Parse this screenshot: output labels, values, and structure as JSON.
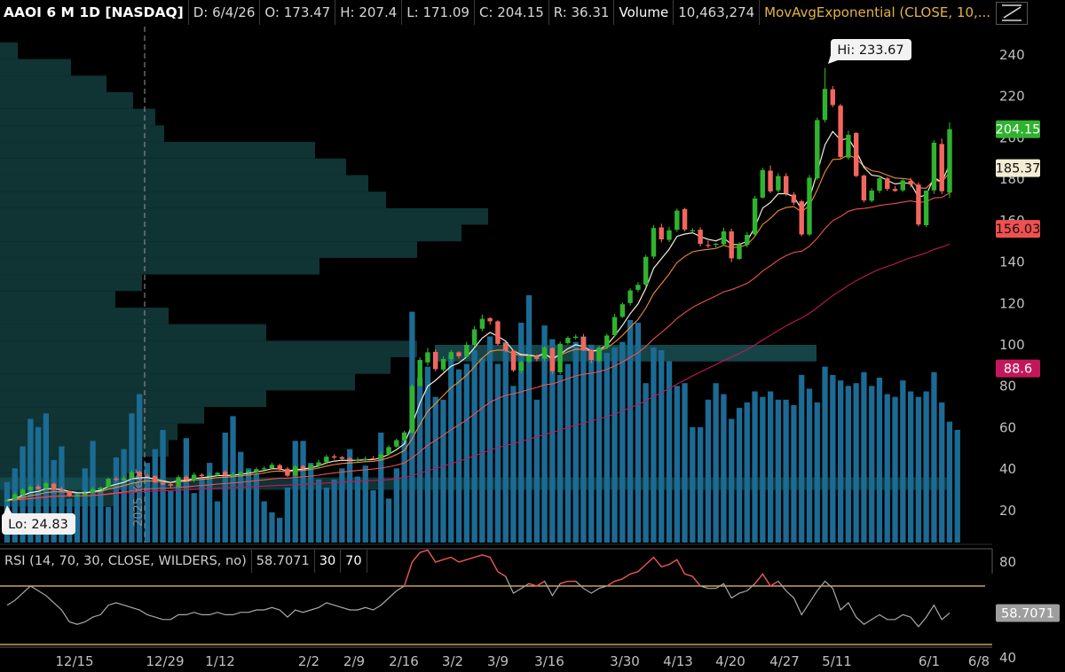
{
  "header": {
    "symbol_label": "AAOI 6 M 1D [NASDAQ]",
    "date": "D: 6/4/26",
    "open": "O: 173.47",
    "high": "H: 207.4",
    "low": "L: 171.09",
    "close": "C: 204.15",
    "range": "R: 36.31",
    "volume_label": "Volume",
    "volume_value": "10,463,274",
    "study_label": "MovAvgExponential (CLOSE, 10,..."
  },
  "rsi_header": {
    "label": "RSI (14, 70, 30, CLOSE, WILDERS, no)",
    "value": "58.7071",
    "lower": "30",
    "upper": "70"
  },
  "colors": {
    "up": "#2fb32f",
    "down": "#f2665f",
    "volume": "#1b6b94",
    "profile": "#0f3433",
    "value_area": "#1d5b5e",
    "ema_fast": "#f3edd6",
    "ema_mid": "#f08b3c",
    "ema_slow": "#f05050",
    "sma_long": "#c2185b",
    "rsi_line": "#a9a9a9",
    "rsi_over": "#f05050",
    "rsi_band": "#f0c36b",
    "tag_close": "#2fb32f",
    "tag_ema": "#f3edd6",
    "tag_slow": "#f05050",
    "tag_long": "#c2185b",
    "tag_rsi": "#9e9e9e",
    "axis_text": "#bfbfbf"
  },
  "chart_data": [
    {
      "type": "candlestick",
      "title": "AAOI 6 M 1D [NASDAQ]",
      "x_ticks": [
        "12/15",
        "12/29",
        "1/12",
        "2/2",
        "2/9",
        "2/16",
        "3/2",
        "3/9",
        "3/16",
        "3/30",
        "4/13",
        "4/20",
        "4/27",
        "5/11",
        "6/1",
        "6/8"
      ],
      "year_marker": "2025 Year",
      "y_ticks": [
        20,
        40,
        60,
        80,
        100,
        120,
        140,
        160,
        180,
        200,
        220,
        240
      ],
      "ylim": [
        4,
        252
      ],
      "grid": false,
      "x": [
        "12/8",
        "12/9",
        "12/10",
        "12/11",
        "12/12",
        "12/15",
        "12/16",
        "12/17",
        "12/18",
        "12/19",
        "12/22",
        "12/23",
        "12/24",
        "12/26",
        "12/29",
        "12/30",
        "12/31",
        "1/2",
        "1/5",
        "1/6",
        "1/7",
        "1/8",
        "1/9",
        "1/12",
        "1/13",
        "1/14",
        "1/15",
        "1/16",
        "1/20",
        "1/21",
        "1/22",
        "1/23",
        "1/26",
        "1/27",
        "1/28",
        "1/29",
        "1/30",
        "2/2",
        "2/3",
        "2/4",
        "2/5",
        "2/6",
        "2/9",
        "2/10",
        "2/11",
        "2/12",
        "2/13",
        "2/17",
        "2/18",
        "2/19",
        "2/20",
        "2/23",
        "2/24",
        "2/25",
        "2/26",
        "2/27",
        "3/2",
        "3/3",
        "3/4",
        "3/5",
        "3/6",
        "3/9",
        "3/10",
        "3/11",
        "3/12",
        "3/13",
        "3/16",
        "3/17",
        "3/18",
        "3/19",
        "3/20",
        "3/23",
        "3/24",
        "3/25",
        "3/26",
        "3/27",
        "3/30",
        "3/31",
        "4/1",
        "4/2",
        "4/6",
        "4/7",
        "4/8",
        "4/9",
        "4/10",
        "4/13",
        "4/14",
        "4/15",
        "4/16",
        "4/17",
        "4/20",
        "4/21",
        "4/22",
        "4/23",
        "4/24",
        "4/27",
        "4/28",
        "4/29",
        "4/30",
        "5/1",
        "5/4",
        "5/5",
        "5/6",
        "5/7",
        "5/8",
        "5/11",
        "5/12",
        "5/13",
        "5/14",
        "5/15",
        "5/18",
        "5/19",
        "5/20",
        "5/21",
        "5/22",
        "5/26",
        "5/27",
        "5/28",
        "5/29",
        "6/1",
        "6/2",
        "6/3",
        "6/4"
      ],
      "open": [
        24.8,
        25.2,
        27.5,
        29.9,
        31.6,
        30.5,
        32.9,
        30.1,
        29.3,
        26.8,
        27.4,
        28.6,
        30.1,
        31.3,
        35.4,
        34.5,
        35.6,
        38.6,
        36.8,
        36.6,
        33.4,
        32.7,
        31.6,
        36.3,
        34.7,
        37.3,
        36.8,
        37.3,
        38.7,
        36.8,
        37.4,
        38.3,
        38.7,
        40.1,
        40.5,
        41.9,
        40.2,
        36.9,
        41.5,
        40.4,
        41.6,
        43.3,
        46.2,
        45.8,
        45.2,
        44.1,
        44.3,
        45.2,
        45.0,
        47.4,
        50.9,
        53.7,
        57.7,
        80.2,
        91.5,
        96.6,
        88.1,
        93.2,
        96.4,
        94.3,
        100.0,
        107.8,
        112.9,
        111.4,
        100.8,
        97.2,
        87.5,
        91.8,
        94.7,
        93.3,
        98.4,
        86.7,
        100.9,
        103.4,
        103.9,
        97.6,
        92.2,
        98.9,
        104.7,
        113.5,
        120.2,
        126.6,
        129.1,
        142.6,
        156.7,
        150.7,
        155.6,
        165.6,
        155.3,
        155.6,
        148.3,
        148.3,
        148.6,
        154.8,
        141.5,
        148.3,
        153.3,
        171.1,
        184.1,
        174.6,
        181.5,
        172.6,
        169.3,
        153.3,
        180.4,
        208.6,
        223.4,
        215.5,
        190.4,
        202.3,
        181.7,
        169.6,
        174.4,
        180.4,
        175.3,
        174.6,
        179.2,
        177.4,
        157.8,
        174.6,
        197.0,
        173.5
      ],
      "close": [
        24.9,
        27.8,
        30.2,
        31.4,
        30.4,
        33.2,
        30.0,
        29.6,
        27.3,
        27.5,
        28.4,
        30.4,
        30.9,
        35.3,
        34.8,
        35.6,
        38.5,
        36.9,
        36.3,
        33.6,
        32.6,
        32.0,
        36.1,
        34.7,
        37.3,
        36.6,
        37.0,
        38.2,
        36.9,
        37.4,
        38.5,
        39.0,
        40.0,
        40.4,
        42.1,
        40.0,
        36.8,
        41.3,
        40.4,
        42.0,
        43.3,
        46.0,
        45.6,
        45.0,
        44.2,
        44.4,
        45.0,
        44.8,
        47.1,
        50.6,
        54.0,
        57.7,
        80.2,
        92.7,
        96.4,
        88.3,
        93.2,
        96.5,
        94.5,
        100.0,
        107.5,
        112.6,
        111.4,
        100.5,
        97.2,
        87.7,
        91.7,
        94.6,
        93.2,
        98.8,
        87.3,
        100.5,
        103.4,
        104.0,
        97.3,
        92.7,
        98.7,
        104.5,
        113.4,
        119.6,
        126.3,
        129.0,
        142.5,
        156.4,
        150.9,
        155.3,
        164.8,
        155.7,
        155.3,
        148.8,
        148.1,
        148.8,
        154.8,
        141.8,
        148.5,
        153.1,
        170.7,
        184.4,
        174.1,
        181.5,
        173.1,
        168.7,
        153.3,
        180.7,
        208.5,
        223.6,
        215.8,
        190.7,
        201.4,
        181.5,
        169.7,
        174.5,
        180.4,
        175.3,
        174.3,
        179.4,
        177.4,
        158.1,
        174.5,
        197.6,
        174.2,
        204.15
      ],
      "high": [
        25.5,
        28.8,
        30.9,
        32.4,
        32.6,
        34.2,
        33.5,
        31.4,
        29.6,
        28.2,
        29.6,
        31.4,
        31.6,
        35.9,
        36.4,
        36.6,
        39.6,
        39.1,
        37.6,
        37.1,
        34.3,
        33.6,
        37.1,
        37.0,
        38.3,
        38.0,
        38.4,
        38.6,
        39.5,
        38.8,
        39.1,
        39.7,
        40.8,
        41.4,
        43.1,
        42.6,
        41.0,
        42.1,
        42.0,
        42.6,
        44.5,
        47.0,
        47.2,
        46.3,
        45.9,
        45.7,
        46.1,
        46.3,
        48.5,
        51.5,
        54.7,
        58.5,
        81.1,
        93.9,
        98.5,
        97.8,
        94.4,
        97.6,
        96.9,
        101.5,
        109.1,
        114.7,
        113.4,
        111.9,
        101.4,
        97.6,
        92.5,
        95.4,
        95.3,
        99.3,
        98.7,
        101.6,
        104.1,
        105.0,
        105.3,
        97.9,
        99.7,
        105.4,
        114.9,
        120.6,
        127.3,
        130.3,
        143.5,
        157.9,
        158.5,
        157.0,
        165.8,
        166.2,
        156.3,
        156.7,
        150.4,
        149.1,
        156.6,
        156.1,
        149.7,
        154.4,
        171.9,
        185.5,
        186.6,
        182.9,
        182.9,
        173.8,
        170.1,
        182.0,
        209.7,
        233.7,
        225.0,
        216.4,
        203.4,
        202.8,
        182.3,
        175.7,
        181.5,
        181.1,
        176.7,
        180.5,
        180.7,
        178.5,
        174.7,
        198.8,
        199.6,
        207.4
      ],
      "low": [
        24.83,
        24.6,
        26.7,
        28.9,
        30.1,
        29.9,
        29.6,
        28.9,
        26.5,
        26.4,
        26.6,
        28.1,
        30.3,
        30.9,
        34.0,
        34.1,
        34.9,
        35.7,
        36.0,
        33.1,
        32.1,
        31.1,
        30.8,
        34.0,
        33.6,
        35.9,
        36.0,
        36.6,
        36.5,
        36.1,
        36.9,
        37.4,
        37.9,
        39.5,
        40.2,
        39.0,
        36.2,
        36.3,
        39.4,
        40.0,
        40.6,
        42.4,
        44.7,
        44.6,
        43.1,
        43.4,
        43.8,
        44.5,
        44.5,
        46.6,
        50.3,
        53.1,
        57.0,
        79.9,
        90.0,
        87.2,
        87.1,
        92.0,
        93.4,
        93.8,
        99.2,
        106.6,
        109.7,
        99.7,
        96.5,
        86.9,
        86.3,
        91.3,
        92.1,
        92.1,
        86.0,
        85.8,
        100.1,
        102.6,
        97.1,
        91.2,
        91.4,
        97.9,
        103.8,
        113.0,
        119.0,
        125.5,
        128.1,
        141.6,
        149.5,
        149.7,
        154.6,
        154.8,
        154.2,
        147.5,
        146.8,
        147.1,
        147.7,
        140.0,
        141.1,
        147.0,
        152.6,
        170.6,
        173.3,
        173.6,
        171.8,
        167.5,
        152.4,
        152.5,
        179.5,
        207.4,
        214.8,
        189.7,
        189.4,
        181.0,
        168.8,
        168.9,
        173.3,
        174.3,
        173.9,
        173.9,
        176.0,
        157.2,
        156.8,
        172.9,
        172.8,
        171.09
      ],
      "hi_label": "Hi: 233.67",
      "lo_label": "Lo: 24.83",
      "price_tags": {
        "last": "204.15",
        "ema": "185.37",
        "ema_slow": "156.03",
        "sma": "88.6"
      }
    },
    {
      "type": "bar",
      "series_name": "Volume",
      "relative_values": [
        0.22,
        0.27,
        0.35,
        0.45,
        0.42,
        0.47,
        0.3,
        0.35,
        0.16,
        0.18,
        0.27,
        0.37,
        0.2,
        0.13,
        0.31,
        0.34,
        0.47,
        0.54,
        0.29,
        0.34,
        0.41,
        0.19,
        0.21,
        0.38,
        0.18,
        0.23,
        0.29,
        0.15,
        0.4,
        0.46,
        0.33,
        0.27,
        0.25,
        0.15,
        0.11,
        0.09,
        0.2,
        0.37,
        0.37,
        0.29,
        0.23,
        0.2,
        0.23,
        0.27,
        0.34,
        0.24,
        0.28,
        0.19,
        0.4,
        0.16,
        0.27,
        0.37,
        0.84,
        0.6,
        0.64,
        0.53,
        0.52,
        0.68,
        0.63,
        0.65,
        0.7,
        0.67,
        0.75,
        0.65,
        0.73,
        0.57,
        0.8,
        0.9,
        0.52,
        0.79,
        0.74,
        0.61,
        0.65,
        0.73,
        0.75,
        0.72,
        0.71,
        0.69,
        0.71,
        0.73,
        0.81,
        0.8,
        0.58,
        0.71,
        0.7,
        0.66,
        0.57,
        0.58,
        0.42,
        0.42,
        0.52,
        0.58,
        0.54,
        0.45,
        0.49,
        0.51,
        0.55,
        0.53,
        0.55,
        0.52,
        0.52,
        0.5,
        0.61,
        0.56,
        0.51,
        0.64,
        0.61,
        0.59,
        0.57,
        0.58,
        0.62,
        0.57,
        0.6,
        0.54,
        0.53,
        0.59,
        0.55,
        0.53,
        0.55,
        0.62,
        0.51,
        0.44,
        0.41
      ]
    },
    {
      "type": "line",
      "title": "RSI (14, 70, 30, CLOSE, WILDERS, no)",
      "y_ticks": [
        40,
        80
      ],
      "ylim": [
        30,
        88
      ],
      "band": 70,
      "values": [
        62,
        64,
        67,
        70,
        68,
        66,
        63,
        60,
        55,
        54,
        55,
        57,
        58,
        62,
        63,
        62,
        61,
        60,
        58,
        57,
        56,
        56,
        58,
        58,
        59,
        58,
        58,
        59,
        58,
        58,
        59,
        59,
        60,
        60,
        61,
        60,
        57,
        60,
        59,
        60,
        61,
        63,
        62,
        61,
        60,
        60,
        61,
        60,
        62,
        65,
        68,
        70,
        80,
        84,
        85,
        80,
        81,
        82,
        80,
        81,
        82,
        83,
        82,
        76,
        74,
        67,
        69,
        71,
        70,
        72,
        66,
        71,
        72,
        72,
        69,
        67,
        69,
        70,
        72,
        73,
        75,
        76,
        79,
        82,
        78,
        79,
        81,
        75,
        74,
        70,
        69,
        69,
        71,
        65,
        67,
        68,
        71,
        75,
        70,
        72,
        68,
        65,
        58,
        63,
        68,
        72,
        69,
        60,
        63,
        57,
        54,
        56,
        58,
        56,
        56,
        58,
        57,
        53,
        57,
        62,
        56,
        58.7071
      ]
    }
  ]
}
